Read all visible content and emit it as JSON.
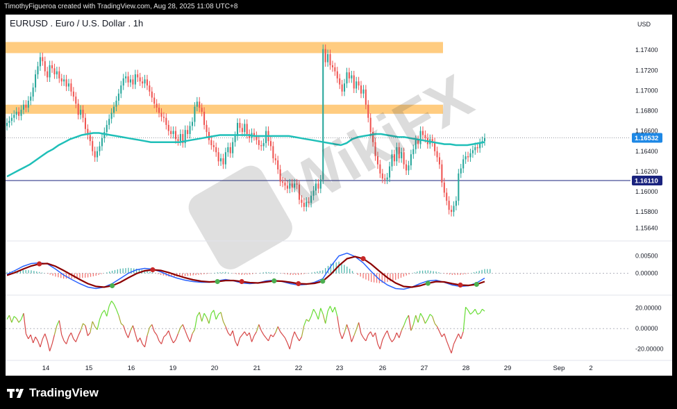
{
  "header": {
    "attribution": "TimothyFigueroa created with TradingView.com, Aug 28, 2025 11:08 UTC+8"
  },
  "footer": {
    "brand": "TradingView"
  },
  "watermark": {
    "text": "WikiFX"
  },
  "colors": {
    "up": "#26a69a",
    "down": "#ef5350",
    "ema": "#1fbfb8",
    "zone": "#ffcc80",
    "macd_line": "#2962ff",
    "signal_line": "#8b0000",
    "cross_up": "#4caf50",
    "cross_down": "#c62828",
    "osc_up": "#66dd33",
    "osc_down": "#d64545",
    "price_badge": "#1e88e5",
    "line_badge": "#1a237e"
  },
  "chart_data": [
    {
      "type": "candlestick",
      "title": "EURUSD . Euro / U.S. Dollar . 1h",
      "currency": "USD",
      "y_ticks": [
        "1.17400",
        "1.17200",
        "1.17000",
        "1.16800",
        "1.16600",
        "1.16400",
        "1.16200",
        "1.16000",
        "1.15800",
        "1.15640"
      ],
      "ylim": [
        1.1554,
        1.176
      ],
      "x_ticks": [
        "14",
        "15",
        "16",
        "19",
        "20",
        "21",
        "22",
        "23",
        "26",
        "27",
        "28",
        "29",
        "Sep",
        "2"
      ],
      "last_price": "1.16532",
      "horizontal_line": "1.16110",
      "zones": [
        {
          "from": 1.1737,
          "to": 1.1748
        },
        {
          "from": 1.1677,
          "to": 1.1686
        }
      ],
      "closes": [
        1.1668,
        1.167,
        1.1673,
        1.1676,
        1.1679,
        1.1675,
        1.1681,
        1.1686,
        1.1683,
        1.169,
        1.1694,
        1.1703,
        1.1716,
        1.1724,
        1.1733,
        1.1729,
        1.1719,
        1.1713,
        1.1725,
        1.1722,
        1.1716,
        1.1719,
        1.1712,
        1.1709,
        1.1711,
        1.1704,
        1.1707,
        1.1699,
        1.1694,
        1.1687,
        1.1676,
        1.1681,
        1.1673,
        1.1662,
        1.1656,
        1.165,
        1.164,
        1.1634,
        1.164,
        1.1645,
        1.1653,
        1.1659,
        1.1666,
        1.1672,
        1.1678,
        1.1684,
        1.169,
        1.1697,
        1.1705,
        1.1712,
        1.1714,
        1.1708,
        1.1711,
        1.1706,
        1.1716,
        1.1713,
        1.1709,
        1.1707,
        1.1711,
        1.1705,
        1.1699,
        1.1693,
        1.1687,
        1.1683,
        1.1678,
        1.1674,
        1.1673,
        1.1666,
        1.166,
        1.1657,
        1.166,
        1.1652,
        1.165,
        1.1657,
        1.1648,
        1.1661,
        1.1657,
        1.1665,
        1.1669,
        1.1684,
        1.1689,
        1.1683,
        1.1679,
        1.1666,
        1.1659,
        1.1651,
        1.1646,
        1.1644,
        1.1639,
        1.163,
        1.1633,
        1.1627,
        1.1639,
        1.1644,
        1.1638,
        1.1649,
        1.1655,
        1.1668,
        1.1663,
        1.1659,
        1.1667,
        1.1657,
        1.1653,
        1.1658,
        1.1655,
        1.1651,
        1.1646,
        1.1645,
        1.1648,
        1.166,
        1.165,
        1.1645,
        1.1633,
        1.1631,
        1.1622,
        1.161,
        1.1609,
        1.1606,
        1.1603,
        1.1608,
        1.1604,
        1.1608,
        1.1607,
        1.1592,
        1.1589,
        1.1585,
        1.159,
        1.1589,
        1.1596,
        1.1601,
        1.1608,
        1.1603,
        1.1612,
        1.1741,
        1.1728,
        1.1736,
        1.1725,
        1.1723,
        1.1719,
        1.1712,
        1.1706,
        1.1699,
        1.1707,
        1.1718,
        1.1712,
        1.1715,
        1.1702,
        1.1709,
        1.1705,
        1.1697,
        1.1701,
        1.1686,
        1.1673,
        1.1659,
        1.1649,
        1.1635,
        1.1627,
        1.1618,
        1.1613,
        1.1612,
        1.1614,
        1.1625,
        1.1637,
        1.163,
        1.1644,
        1.1633,
        1.1639,
        1.1627,
        1.1621,
        1.1626,
        1.1637,
        1.1642,
        1.1651,
        1.1647,
        1.166,
        1.1656,
        1.1653,
        1.1647,
        1.1652,
        1.1649,
        1.164,
        1.1634,
        1.1627,
        1.1609,
        1.1599,
        1.1591,
        1.1582,
        1.158,
        1.1586,
        1.1591,
        1.1618,
        1.1623,
        1.1632,
        1.1635,
        1.1634,
        1.1638,
        1.1641,
        1.1644,
        1.1643,
        1.1648,
        1.165,
        1.1653
      ],
      "ema": [
        1.1615,
        1.1618,
        1.1621,
        1.1624,
        1.1627,
        1.1631,
        1.1635,
        1.1639,
        1.1642,
        1.1646,
        1.1649,
        1.1652,
        1.1654,
        1.1656,
        1.1657,
        1.1658,
        1.1658,
        1.1657,
        1.1656,
        1.1655,
        1.1654,
        1.1653,
        1.1652,
        1.1651,
        1.165,
        1.1649,
        1.1649,
        1.1649,
        1.1649,
        1.1649,
        1.1649,
        1.165,
        1.1651,
        1.1652,
        1.1653,
        1.1654,
        1.1655,
        1.1656,
        1.1656,
        1.1656,
        1.1656,
        1.1656,
        1.1656,
        1.1655,
        1.1655,
        1.1655,
        1.1655,
        1.1655,
        1.1655,
        1.1655,
        1.1654,
        1.1653,
        1.1652,
        1.1651,
        1.165,
        1.1649,
        1.1648,
        1.1647,
        1.1646,
        1.1648,
        1.1652,
        1.1654,
        1.1655,
        1.1656,
        1.1657,
        1.1657,
        1.1656,
        1.1655,
        1.1654,
        1.1654,
        1.1653,
        1.1652,
        1.1651,
        1.165,
        1.1649,
        1.1648,
        1.1647,
        1.1647,
        1.1646,
        1.1646,
        1.1646,
        1.1647,
        1.1648,
        1.1649
      ]
    },
    {
      "type": "macd",
      "y_ticks": [
        "0.00500",
        "0.00000"
      ],
      "ylim": [
        -0.0055,
        0.0085
      ],
      "macd": [
        -0.0003,
        0.0008,
        0.002,
        0.0028,
        0.003,
        0.0027,
        0.0012,
        -0.0005,
        -0.0018,
        -0.003,
        -0.004,
        -0.0044,
        -0.004,
        -0.003,
        -0.0015,
        0.0,
        0.001,
        0.0014,
        0.0012,
        0.0004,
        -0.0006,
        -0.0014,
        -0.002,
        -0.0024,
        -0.0026,
        -0.0026,
        -0.0022,
        -0.0018,
        -0.0022,
        -0.0028,
        -0.003,
        -0.0028,
        -0.0022,
        -0.002,
        -0.0024,
        -0.003,
        -0.0034,
        -0.0032,
        -0.0026,
        -0.0016,
        0.002,
        0.005,
        0.0058,
        0.0048,
        0.003,
        0.0005,
        -0.0018,
        -0.0034,
        -0.0044,
        -0.0046,
        -0.004,
        -0.003,
        -0.0022,
        -0.002,
        -0.0026,
        -0.0034,
        -0.0038,
        -0.0036,
        -0.0028,
        -0.0014
      ],
      "signal": [
        -0.0006,
        0.0002,
        0.0012,
        0.0021,
        0.0027,
        0.0028,
        0.002,
        0.0008,
        -0.0005,
        -0.0018,
        -0.003,
        -0.0038,
        -0.004,
        -0.0036,
        -0.0026,
        -0.0013,
        -0.0001,
        0.0007,
        0.001,
        0.0008,
        0.0002,
        -0.0006,
        -0.0013,
        -0.0019,
        -0.0023,
        -0.0025,
        -0.0024,
        -0.0021,
        -0.0021,
        -0.0024,
        -0.0027,
        -0.0028,
        -0.0025,
        -0.0022,
        -0.0023,
        -0.0026,
        -0.003,
        -0.0031,
        -0.0029,
        -0.0023,
        -0.0003,
        0.0022,
        0.0042,
        0.0048,
        0.0042,
        0.0026,
        0.0006,
        -0.0013,
        -0.0028,
        -0.0038,
        -0.004,
        -0.0036,
        -0.0029,
        -0.0024,
        -0.0025,
        -0.003,
        -0.0034,
        -0.0035,
        -0.0032,
        -0.0024
      ],
      "crosses": [
        {
          "i": 4,
          "dir": "down"
        },
        {
          "i": 13,
          "dir": "up"
        },
        {
          "i": 18,
          "dir": "down"
        },
        {
          "i": 26,
          "dir": "up"
        },
        {
          "i": 29,
          "dir": "down"
        },
        {
          "i": 33,
          "dir": "up"
        },
        {
          "i": 36,
          "dir": "down"
        },
        {
          "i": 39,
          "dir": "up"
        },
        {
          "i": 44,
          "dir": "down"
        },
        {
          "i": 52,
          "dir": "up"
        },
        {
          "i": 56,
          "dir": "down"
        },
        {
          "i": 58,
          "dir": "up"
        }
      ]
    },
    {
      "type": "oscillator",
      "y_ticks": [
        "20.00000",
        "0.00000",
        "-20.00000"
      ],
      "ylim": [
        -29,
        30
      ],
      "values": [
        9,
        13,
        6,
        12,
        10,
        6,
        9,
        15,
        -5,
        -10,
        -6,
        -14,
        -8,
        -12,
        -18,
        -10,
        -5,
        -12,
        -22,
        -15,
        -6,
        3,
        8,
        -6,
        -12,
        -15,
        -8,
        -4,
        -10,
        -13,
        -7,
        -2,
        5,
        3,
        -7,
        -4,
        7,
        2,
        -1,
        9,
        15,
        18,
        12,
        22,
        27,
        24,
        19,
        13,
        5,
        3,
        -4,
        -9,
        -2,
        3,
        -5,
        -13,
        -9,
        -15,
        -18,
        -7,
        1,
        4,
        -3,
        -6,
        -12,
        -15,
        -8,
        -6,
        -2,
        -9,
        -14,
        -11,
        -5,
        1,
        4,
        -2,
        -8,
        -13,
        -5,
        -1,
        12,
        16,
        7,
        15,
        11,
        5,
        15,
        18,
        9,
        14,
        16,
        7,
        2,
        -4,
        -7,
        -2,
        -12,
        -17,
        -9,
        -6,
        -3,
        -7,
        -4,
        -13,
        -7,
        -3,
        4,
        -2,
        -6,
        -9,
        -12,
        -6,
        -8,
        -4,
        2,
        -3,
        -6,
        -9,
        -14,
        -20,
        -10,
        -3,
        -8,
        -12,
        -8,
        3,
        9,
        7,
        12,
        19,
        15,
        9,
        20,
        14,
        5,
        17,
        22,
        16,
        21,
        12,
        -3,
        -10,
        -4,
        4,
        -3,
        -13,
        -7,
        -1,
        6,
        -5,
        -9,
        -12,
        -6,
        -3,
        -8,
        -4,
        -15,
        -20,
        -11,
        -6,
        -2,
        -9,
        -13,
        -10,
        -4,
        -9,
        -2,
        3,
        9,
        13,
        -2,
        4,
        13,
        6,
        15,
        11,
        5,
        9,
        14,
        12,
        5,
        2,
        -3,
        -8,
        -5,
        -12,
        -18,
        -24,
        -15,
        -10,
        -5,
        -10,
        -3,
        21,
        18,
        14,
        16,
        19,
        14,
        15,
        19,
        17
      ],
      "split_index": 190
    }
  ]
}
